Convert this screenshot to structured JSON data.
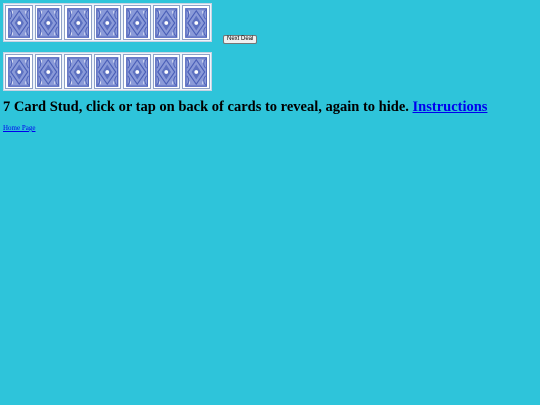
{
  "controls": {
    "next_deal_label": "Next Deal"
  },
  "tables": [
    {
      "cards": [
        "back",
        "back",
        "back",
        "back",
        "back",
        "back",
        "back"
      ]
    },
    {
      "cards": [
        "back",
        "back",
        "back",
        "back",
        "back",
        "back",
        "back"
      ]
    }
  ],
  "card_back": {
    "pattern_color": "#4a5fb8",
    "field_color": "#8a9ad8",
    "border_color": "#ffffff"
  },
  "heading": {
    "text": "7 Card Stud, click or tap on back of cards to reveal, again to hide.",
    "instructions_link": "Instructions"
  },
  "footer": {
    "home_link": "Home Page"
  },
  "colors": {
    "background": "#2ec4da",
    "link": "#0000ee"
  }
}
